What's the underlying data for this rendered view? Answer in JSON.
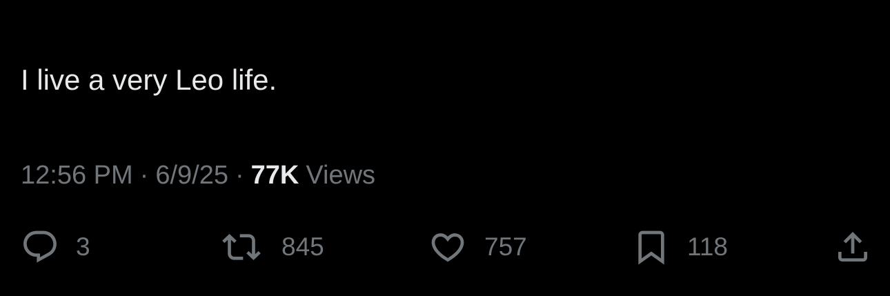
{
  "tweet": {
    "text": "I live a very Leo life.",
    "time": "12:56 PM",
    "date": "6/9/25",
    "separator": "·",
    "views_count": "77K",
    "views_label": "Views"
  },
  "actions": {
    "reply": {
      "icon": "reply-icon",
      "count": "3"
    },
    "retweet": {
      "icon": "retweet-icon",
      "count": "845"
    },
    "like": {
      "icon": "heart-icon",
      "count": "757"
    },
    "bookmark": {
      "icon": "bookmark-icon",
      "count": "118"
    },
    "share": {
      "icon": "share-icon"
    }
  },
  "colors": {
    "background": "#000000",
    "text": "#e7e9ea",
    "secondary": "#71767b"
  }
}
